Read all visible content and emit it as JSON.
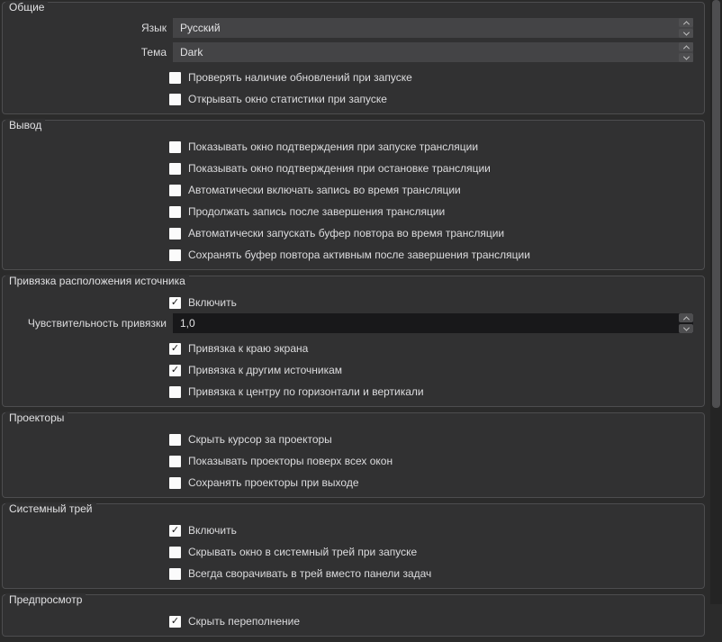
{
  "theme_colors": {
    "page_background": "#2b2b2b",
    "group_background": "#313132",
    "group_border": "#4d4d4f",
    "combobox_background": "#444446",
    "spinbox_background": "#18181a",
    "text": "#dcdcde",
    "checkbox_fill": "#fbfbfb",
    "scroll_thumb": "#4e4e50"
  },
  "groups": [
    {
      "name": "general",
      "title": "Общие",
      "rows": [
        {
          "type": "combo",
          "name": "language",
          "label": "Язык",
          "value": "Русский"
        },
        {
          "type": "combo",
          "name": "theme",
          "label": "Тема",
          "value": "Dark"
        },
        {
          "type": "check",
          "name": "check-updates",
          "checked": false,
          "label": "Проверять наличие обновлений при запуске"
        },
        {
          "type": "check",
          "name": "open-stats",
          "checked": false,
          "label": "Открывать окно статистики при запуске"
        }
      ]
    },
    {
      "name": "output",
      "title": "Вывод",
      "rows": [
        {
          "type": "check",
          "name": "confirm-start-stream",
          "checked": false,
          "label": "Показывать окно подтверждения при запуске трансляции"
        },
        {
          "type": "check",
          "name": "confirm-stop-stream",
          "checked": false,
          "label": "Показывать окно подтверждения при остановке трансляции"
        },
        {
          "type": "check",
          "name": "auto-record-when-streaming",
          "checked": false,
          "label": "Автоматически включать запись во время трансляции"
        },
        {
          "type": "check",
          "name": "keep-recording-after-stream",
          "checked": false,
          "label": "Продолжать запись после завершения трансляции"
        },
        {
          "type": "check",
          "name": "auto-start-replay-buffer",
          "checked": false,
          "label": "Автоматически запускать буфер повтора во время трансляции"
        },
        {
          "type": "check",
          "name": "keep-replay-buffer-after-stream",
          "checked": false,
          "label": "Сохранять буфер повтора активным после завершения трансляции"
        }
      ]
    },
    {
      "name": "source-snapping",
      "title": "Привязка расположения источника",
      "rows": [
        {
          "type": "check",
          "name": "enable-snapping",
          "checked": true,
          "label": "Включить"
        },
        {
          "type": "spin",
          "name": "snap-sensitivity",
          "label": "Чувствительность привязки",
          "value": "1,0"
        },
        {
          "type": "check",
          "name": "snap-to-screen-edge",
          "checked": true,
          "label": "Привязка к краю экрана"
        },
        {
          "type": "check",
          "name": "snap-to-other-sources",
          "checked": true,
          "label": "Привязка к другим источникам"
        },
        {
          "type": "check",
          "name": "snap-to-center",
          "checked": false,
          "label": "Привязка к центру по горизонтали и вертикали"
        }
      ]
    },
    {
      "name": "projectors",
      "title": "Проекторы",
      "rows": [
        {
          "type": "check",
          "name": "hide-cursor-over-projectors",
          "checked": false,
          "label": "Скрыть курсор за проекторы"
        },
        {
          "type": "check",
          "name": "projectors-always-on-top",
          "checked": false,
          "label": "Показывать проекторы поверх всех окон"
        },
        {
          "type": "check",
          "name": "save-projectors-on-exit",
          "checked": false,
          "label": "Сохранять проекторы при выходе"
        }
      ]
    },
    {
      "name": "system-tray",
      "title": "Системный трей",
      "rows": [
        {
          "type": "check",
          "name": "enable-tray",
          "checked": true,
          "label": "Включить"
        },
        {
          "type": "check",
          "name": "minimize-to-tray-on-start",
          "checked": false,
          "label": "Скрывать окно в системный трей при запуске"
        },
        {
          "type": "check",
          "name": "always-minimize-to-tray",
          "checked": false,
          "label": "Всегда сворачивать в трей вместо панели задач"
        }
      ]
    },
    {
      "name": "preview",
      "title": "Предпросмотр",
      "rows": [
        {
          "type": "check",
          "name": "hide-overflow",
          "checked": true,
          "label": "Скрыть переполнение"
        }
      ]
    }
  ]
}
